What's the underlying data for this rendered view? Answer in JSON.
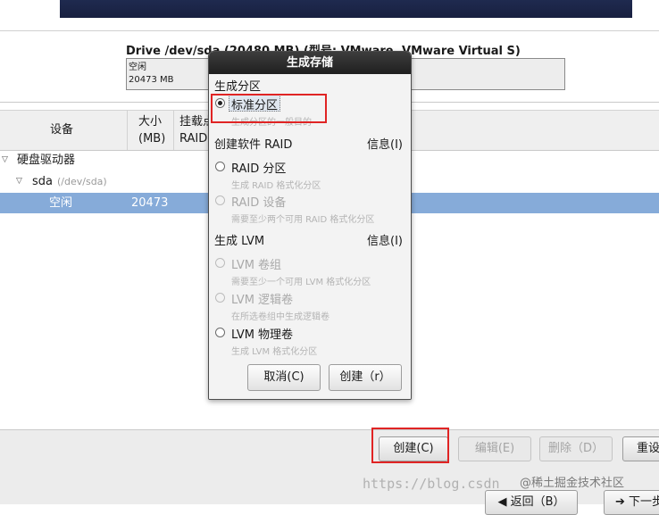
{
  "drive": {
    "title": "Drive /dev/sda (20480 MB) (型号: VMware, VMware Virtual S)",
    "free_label": "空闲",
    "free_size": "20473 MB"
  },
  "table": {
    "headers": {
      "device": "设备",
      "size_line1": "大小",
      "size_line2": "(MB)",
      "mount_line1": "挂载点",
      "mount_line2": "RAID"
    },
    "rows": [
      {
        "label": "硬盘驱动器",
        "detail": "",
        "size": ""
      },
      {
        "label": "sda",
        "detail": "(/dev/sda)",
        "size": ""
      },
      {
        "label": "空闲",
        "detail": "",
        "size": "20473"
      }
    ]
  },
  "dialog": {
    "title": "生成存储",
    "section_partition": "生成分区",
    "opt_standard": "标准分区",
    "opt_standard_desc": "生成分区的一般目的",
    "section_raid": "创建软件 RAID",
    "info_raid": "信息(I)",
    "opt_raid_partition": "RAID 分区",
    "opt_raid_partition_desc": "生成 RAID 格式化分区",
    "opt_raid_device": "RAID 设备",
    "opt_raid_device_desc": "需要至少两个可用 RAID 格式化分区",
    "section_lvm": "生成 LVM",
    "info_lvm": "信息(I)",
    "opt_lvm_vg": "LVM 卷组",
    "opt_lvm_vg_desc": "需要至少一个可用 LVM 格式化分区",
    "opt_lvm_lv": "LVM 逻辑卷",
    "opt_lvm_lv_desc": "在所选卷组中生成逻辑卷",
    "opt_lvm_pv": "LVM 物理卷",
    "opt_lvm_pv_desc": "生成 LVM 格式化分区",
    "cancel": "取消(C)",
    "create": "创建（r）"
  },
  "toolbar": {
    "create": "创建(C)",
    "edit": "编辑(E)",
    "delete": "删除（D）",
    "reset": "重设"
  },
  "nav": {
    "back": "返回（B）",
    "next": "下一步"
  },
  "watermark": {
    "url": "https://blog.csdn",
    "site": "@稀土掘金技术社区"
  },
  "colors": {
    "selection": "#86abd9",
    "highlight_box": "#e02424",
    "dialog_title_bg": "#2a2a2a"
  }
}
